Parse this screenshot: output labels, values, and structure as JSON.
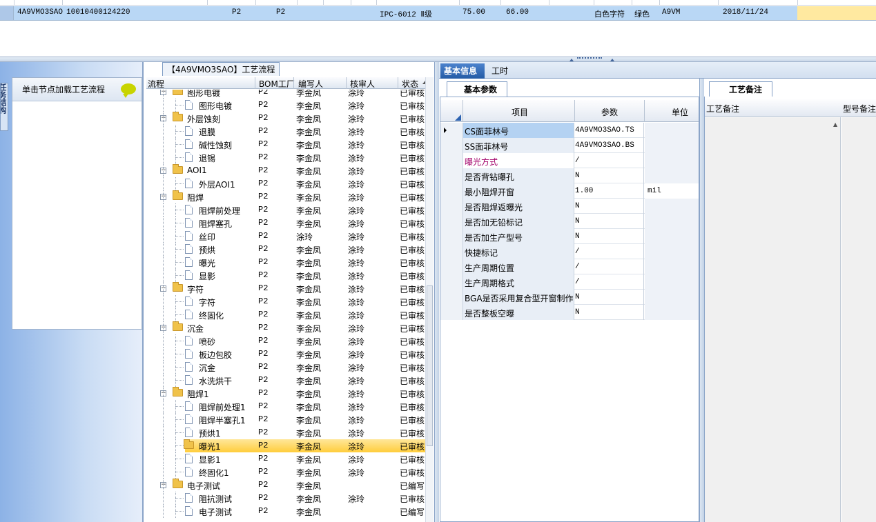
{
  "top_row": {
    "cells": [
      {
        "text": "4A9VMO3SAO"
      },
      {
        "text": "10010400124220"
      },
      {
        "text": "P2"
      },
      {
        "text": "P2"
      },
      {
        "text": "IPC-6012 Ⅱ级"
      },
      {
        "text": "75.00"
      },
      {
        "text": "66.00"
      },
      {
        "text": "白色字符"
      },
      {
        "text": "绿色"
      },
      {
        "text": "A9VM"
      },
      {
        "text": "2018/11/24"
      }
    ]
  },
  "sidebar": {
    "vertical_tab": "任务结构",
    "panel_title": "单击节点加载工艺流程"
  },
  "tree": {
    "tab_title": "【4A9VMO3SAO】工艺流程",
    "headers": {
      "flow": "流程",
      "bom": "BOM工厂",
      "writer": "编写人",
      "reviewer": "核审人",
      "status": "状态"
    },
    "rows": [
      {
        "level": 1,
        "name": "图形电镀",
        "factory": "P2",
        "writer": "李金凤",
        "reviewer": "涂玲",
        "status": "已审核"
      },
      {
        "level": 2,
        "name": "图形电镀",
        "factory": "P2",
        "writer": "李金凤",
        "reviewer": "涂玲",
        "status": "已审核"
      },
      {
        "level": 1,
        "name": "外层蚀刻",
        "factory": "P2",
        "writer": "李金凤",
        "reviewer": "涂玲",
        "status": "已审核"
      },
      {
        "level": 2,
        "name": "退膜",
        "factory": "P2",
        "writer": "李金凤",
        "reviewer": "涂玲",
        "status": "已审核"
      },
      {
        "level": 2,
        "name": "碱性蚀刻",
        "factory": "P2",
        "writer": "李金凤",
        "reviewer": "涂玲",
        "status": "已审核"
      },
      {
        "level": 2,
        "name": "退锡",
        "factory": "P2",
        "writer": "李金凤",
        "reviewer": "涂玲",
        "status": "已审核"
      },
      {
        "level": 1,
        "name": "AOI1",
        "factory": "P2",
        "writer": "李金凤",
        "reviewer": "涂玲",
        "status": "已审核"
      },
      {
        "level": 2,
        "name": "外层AOI1",
        "factory": "P2",
        "writer": "李金凤",
        "reviewer": "涂玲",
        "status": "已审核"
      },
      {
        "level": 1,
        "name": "阻焊",
        "factory": "P2",
        "writer": "李金凤",
        "reviewer": "涂玲",
        "status": "已审核"
      },
      {
        "level": 2,
        "name": "阻焊前处理",
        "factory": "P2",
        "writer": "李金凤",
        "reviewer": "涂玲",
        "status": "已审核"
      },
      {
        "level": 2,
        "name": "阻焊塞孔",
        "factory": "P2",
        "writer": "李金凤",
        "reviewer": "涂玲",
        "status": "已审核"
      },
      {
        "level": 2,
        "name": "丝印",
        "factory": "P2",
        "writer": "涂玲",
        "reviewer": "涂玲",
        "status": "已审核"
      },
      {
        "level": 2,
        "name": "预烘",
        "factory": "P2",
        "writer": "李金凤",
        "reviewer": "涂玲",
        "status": "已审核"
      },
      {
        "level": 2,
        "name": "曝光",
        "factory": "P2",
        "writer": "李金凤",
        "reviewer": "涂玲",
        "status": "已审核"
      },
      {
        "level": 2,
        "name": "显影",
        "factory": "P2",
        "writer": "李金凤",
        "reviewer": "涂玲",
        "status": "已审核"
      },
      {
        "level": 1,
        "name": "字符",
        "factory": "P2",
        "writer": "李金凤",
        "reviewer": "涂玲",
        "status": "已审核"
      },
      {
        "level": 2,
        "name": "字符",
        "factory": "P2",
        "writer": "李金凤",
        "reviewer": "涂玲",
        "status": "已审核"
      },
      {
        "level": 2,
        "name": "终固化",
        "factory": "P2",
        "writer": "李金凤",
        "reviewer": "涂玲",
        "status": "已审核"
      },
      {
        "level": 1,
        "name": "沉金",
        "factory": "P2",
        "writer": "李金凤",
        "reviewer": "涂玲",
        "status": "已审核"
      },
      {
        "level": 2,
        "name": "喷砂",
        "factory": "P2",
        "writer": "李金凤",
        "reviewer": "涂玲",
        "status": "已审核"
      },
      {
        "level": 2,
        "name": "板边包胶",
        "factory": "P2",
        "writer": "李金凤",
        "reviewer": "涂玲",
        "status": "已审核"
      },
      {
        "level": 2,
        "name": "沉金",
        "factory": "P2",
        "writer": "李金凤",
        "reviewer": "涂玲",
        "status": "已审核"
      },
      {
        "level": 2,
        "name": "水洗烘干",
        "factory": "P2",
        "writer": "李金凤",
        "reviewer": "涂玲",
        "status": "已审核"
      },
      {
        "level": 1,
        "name": "阻焊1",
        "factory": "P2",
        "writer": "李金凤",
        "reviewer": "涂玲",
        "status": "已审核"
      },
      {
        "level": 2,
        "name": "阻焊前处理1",
        "factory": "P2",
        "writer": "李金凤",
        "reviewer": "涂玲",
        "status": "已审核"
      },
      {
        "level": 2,
        "name": "阻焊半塞孔1",
        "factory": "P2",
        "writer": "李金凤",
        "reviewer": "涂玲",
        "status": "已审核"
      },
      {
        "level": 2,
        "name": "预烘1",
        "factory": "P2",
        "writer": "李金凤",
        "reviewer": "涂玲",
        "status": "已审核"
      },
      {
        "level": 2,
        "name": "曝光1",
        "factory": "P2",
        "writer": "李金凤",
        "reviewer": "涂玲",
        "status": "已审核",
        "selected": true
      },
      {
        "level": 2,
        "name": "显影1",
        "factory": "P2",
        "writer": "李金凤",
        "reviewer": "涂玲",
        "status": "已审核"
      },
      {
        "level": 2,
        "name": "终固化1",
        "factory": "P2",
        "writer": "李金凤",
        "reviewer": "涂玲",
        "status": "已审核"
      },
      {
        "level": 1,
        "name": "电子测试",
        "factory": "P2",
        "writer": "李金凤",
        "reviewer": "",
        "status": "已编写"
      },
      {
        "level": 2,
        "name": "阻抗测试",
        "factory": "P2",
        "writer": "李金凤",
        "reviewer": "涂玲",
        "status": "已审核"
      },
      {
        "level": 2,
        "name": "电子测试",
        "factory": "P2",
        "writer": "李金凤",
        "reviewer": "",
        "status": "已编写"
      }
    ]
  },
  "info": {
    "tabs": {
      "basic": "基本信息",
      "time": "工时"
    },
    "sub_tab": "基本参数",
    "headers": {
      "item": "项目",
      "param": "参数",
      "unit": "单位"
    },
    "rows": [
      {
        "key": "CS面菲林号",
        "value": "4A9VMO3SAO.TS",
        "unit": "",
        "current": true
      },
      {
        "key": "SS面菲林号",
        "value": "4A9VMO3SAO.BS",
        "unit": ""
      },
      {
        "key": "曝光方式",
        "value": "/",
        "unit": "",
        "pink": true
      },
      {
        "key": "是否背钻曝孔",
        "value": "N",
        "unit": ""
      },
      {
        "key": "最小阻焊开窗",
        "value": "1.00",
        "unit": "mil"
      },
      {
        "key": "是否阻焊返曝光",
        "value": "N",
        "unit": ""
      },
      {
        "key": "是否加无铅标记",
        "value": "N",
        "unit": ""
      },
      {
        "key": "是否加生产型号",
        "value": "N",
        "unit": ""
      },
      {
        "key": "快捷标记",
        "value": "/",
        "unit": ""
      },
      {
        "key": "生产周期位置",
        "value": "/",
        "unit": ""
      },
      {
        "key": "生产周期格式",
        "value": "/",
        "unit": ""
      },
      {
        "key": "BGA是否采用复合型开窗制作",
        "value": "N",
        "unit": ""
      },
      {
        "key": "是否整板空曝",
        "value": "N",
        "unit": ""
      }
    ]
  },
  "remarks": {
    "tab": "工艺备注",
    "col1": "工艺备注",
    "col2": "型号备注"
  },
  "colors": {
    "selection": "#b9d7f5",
    "highlight": "#ffcd3c",
    "tab_active": "#2d63b1",
    "pink": "#a3006a"
  }
}
